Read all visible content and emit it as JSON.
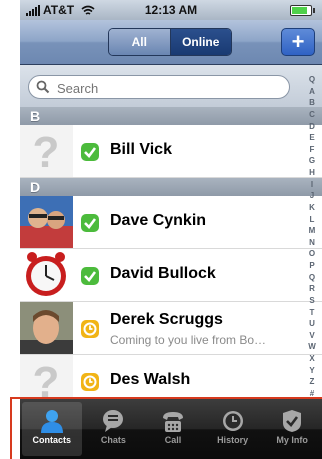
{
  "status_bar": {
    "carrier": "AT&T",
    "time": "12:13 AM",
    "battery_level": 0.85
  },
  "nav": {
    "segments": [
      {
        "label": "All",
        "selected": false
      },
      {
        "label": "Online",
        "selected": true
      }
    ],
    "add_label": "+"
  },
  "search": {
    "placeholder": "Search"
  },
  "sections": [
    {
      "letter": "B",
      "contacts": [
        {
          "name": "Bill Vick",
          "status": "available",
          "message": "",
          "avatar": "unknown-avatar"
        }
      ]
    },
    {
      "letter": "D",
      "contacts": [
        {
          "name": "Dave Cynkin",
          "status": "available",
          "message": "",
          "avatar": "photo-avatar"
        },
        {
          "name": "David Bullock",
          "status": "available",
          "message": "",
          "avatar": "clock-avatar"
        },
        {
          "name": "Derek Scruggs",
          "status": "away",
          "message": "Coming to you live from Bo…",
          "avatar": "photo-avatar"
        },
        {
          "name": "Des Walsh",
          "status": "away",
          "message": "",
          "avatar": "unknown-avatar"
        }
      ]
    }
  ],
  "index_letters": [
    "Q",
    "A",
    "B",
    "C",
    "D",
    "E",
    "F",
    "G",
    "H",
    "I",
    "J",
    "K",
    "L",
    "M",
    "N",
    "O",
    "P",
    "Q",
    "R",
    "S",
    "T",
    "U",
    "V",
    "W",
    "X",
    "Y",
    "Z",
    "#"
  ],
  "tabs": [
    {
      "label": "Contacts",
      "icon": "person-icon",
      "active": true
    },
    {
      "label": "Chats",
      "icon": "chat-bubble-icon",
      "active": false
    },
    {
      "label": "Call",
      "icon": "phone-icon",
      "active": false
    },
    {
      "label": "History",
      "icon": "clock-icon",
      "active": false
    },
    {
      "label": "My Info",
      "icon": "checkmark-shield-icon",
      "active": false
    }
  ],
  "colors": {
    "available": "#4cbb3c",
    "away": "#f1b416",
    "annotation": "#d73a1e",
    "active_tab": "#2f8ee6"
  }
}
